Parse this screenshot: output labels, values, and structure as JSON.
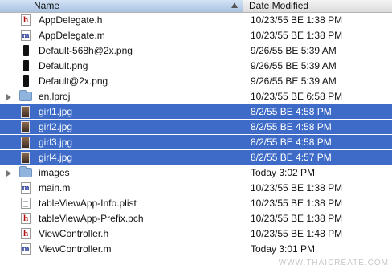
{
  "header": {
    "name_label": "Name",
    "date_label": "Date Modified"
  },
  "files": [
    {
      "name": "AppDelegate.h",
      "date": "10/23/55 BE 1:38 PM",
      "icon": "header-file-icon",
      "glyph": "h",
      "selected": false,
      "folder": false
    },
    {
      "name": "AppDelegate.m",
      "date": "10/23/55 BE 1:38 PM",
      "icon": "implementation-file-icon",
      "glyph": "m",
      "selected": false,
      "folder": false
    },
    {
      "name": "Default-568h@2x.png",
      "date": "9/26/55 BE 5:39 AM",
      "icon": "phone-image-icon",
      "glyph": "",
      "selected": false,
      "folder": false
    },
    {
      "name": "Default.png",
      "date": "9/26/55 BE 5:39 AM",
      "icon": "phone-image-icon",
      "glyph": "",
      "selected": false,
      "folder": false
    },
    {
      "name": "Default@2x.png",
      "date": "9/26/55 BE 5:39 AM",
      "icon": "phone-image-icon",
      "glyph": "",
      "selected": false,
      "folder": false
    },
    {
      "name": "en.lproj",
      "date": "10/23/55 BE 6:58 PM",
      "icon": "folder-icon",
      "glyph": "",
      "selected": false,
      "folder": true
    },
    {
      "name": "girl1.jpg",
      "date": "8/2/55 BE 4:58 PM",
      "icon": "photo-thumbnail-icon",
      "glyph": "",
      "selected": true,
      "folder": false
    },
    {
      "name": "girl2.jpg",
      "date": "8/2/55 BE 4:58 PM",
      "icon": "photo-thumbnail-icon",
      "glyph": "",
      "selected": true,
      "folder": false
    },
    {
      "name": "girl3.jpg",
      "date": "8/2/55 BE 4:58 PM",
      "icon": "photo-thumbnail-icon",
      "glyph": "",
      "selected": true,
      "folder": false
    },
    {
      "name": "girl4.jpg",
      "date": "8/2/55 BE 4:57 PM",
      "icon": "photo-thumbnail-icon",
      "glyph": "",
      "selected": true,
      "folder": false
    },
    {
      "name": "images",
      "date": "Today 3:02 PM",
      "icon": "folder-icon",
      "glyph": "",
      "selected": false,
      "folder": true
    },
    {
      "name": "main.m",
      "date": "10/23/55 BE 1:38 PM",
      "icon": "implementation-file-icon",
      "glyph": "m",
      "selected": false,
      "folder": false
    },
    {
      "name": "tableViewApp-Info.plist",
      "date": "10/23/55 BE 1:38 PM",
      "icon": "document-icon",
      "glyph": "",
      "selected": false,
      "folder": false
    },
    {
      "name": "tableViewApp-Prefix.pch",
      "date": "10/23/55 BE 1:38 PM",
      "icon": "header-file-icon",
      "glyph": "h",
      "selected": false,
      "folder": false
    },
    {
      "name": "ViewController.h",
      "date": "10/23/55 BE 1:48 PM",
      "icon": "header-file-icon",
      "glyph": "h",
      "selected": false,
      "folder": false
    },
    {
      "name": "ViewController.m",
      "date": "Today 3:01 PM",
      "icon": "implementation-file-icon",
      "glyph": "m",
      "selected": false,
      "folder": false
    }
  ],
  "watermark": "WWW.THAICREATE.COM",
  "colors": {
    "selection": "#3d6bc7",
    "header_sorted": "#a9c3e2"
  }
}
